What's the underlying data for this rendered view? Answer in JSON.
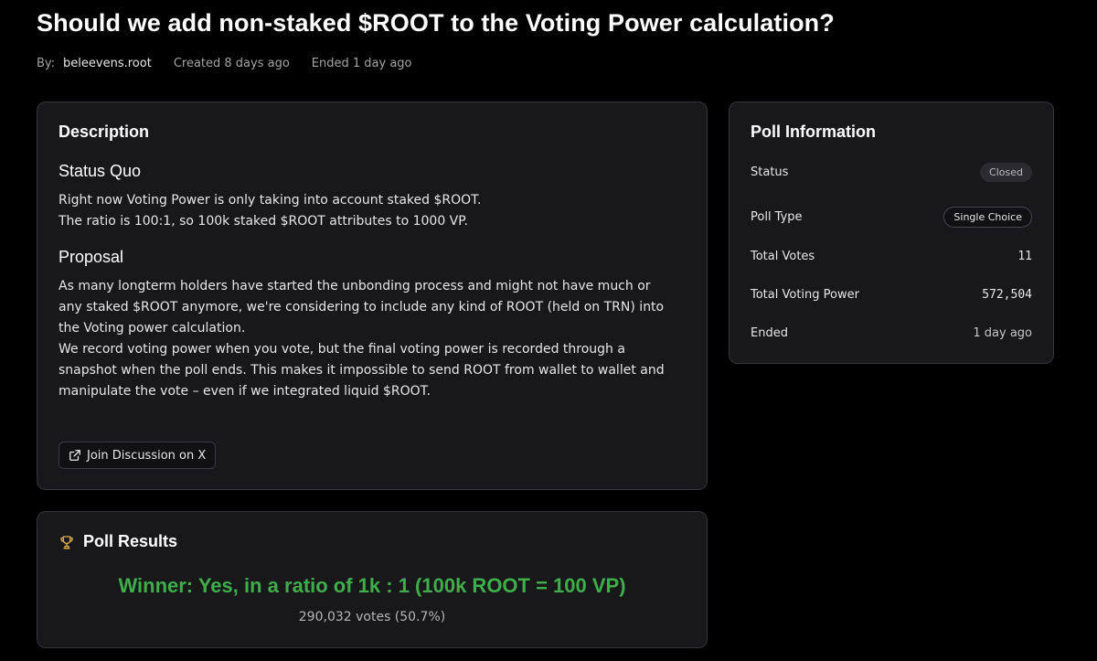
{
  "poll": {
    "title": "Should we add non-staked $ROOT to the Voting Power calculation?",
    "author_label": "By:",
    "author": "beleevens.root",
    "created": "Created 8 days ago",
    "ended": "Ended 1 day ago"
  },
  "description": {
    "heading": "Description",
    "status_quo": {
      "heading": "Status Quo",
      "lines": [
        "Right now Voting Power is only taking into account staked $ROOT.",
        "The ratio is 100:1, so 100k staked $ROOT attributes to 1000 VP."
      ]
    },
    "proposal": {
      "heading": "Proposal",
      "lines": [
        "As many longterm holders have started the unbonding process and might not have much or",
        "any staked $ROOT anymore, we're considering to include any kind of ROOT (held on TRN) into",
        "the Voting power calculation.",
        "We record voting power when you vote, but the final voting power is recorded through a",
        "snapshot when the poll ends. This makes it impossible to send ROOT from wallet to wallet and",
        "manipulate the vote – even if we integrated liquid $ROOT."
      ]
    },
    "discussion_button": "Join Discussion on X",
    "discussion_icon": "external-link-icon"
  },
  "poll_info": {
    "heading": "Poll Information",
    "status_label": "Status",
    "status_value": "Closed",
    "type_label": "Poll Type",
    "type_value": "Single Choice",
    "votes_label": "Total Votes",
    "votes_value": "11",
    "power_label": "Total Voting Power",
    "power_value": "572,504",
    "ended_label": "Ended",
    "ended_value": "1 day ago"
  },
  "results": {
    "heading": "Poll Results",
    "icon": "trophy-icon",
    "winner": "Winner: Yes, in a ratio of 1k : 1 (100k ROOT = 100 VP)",
    "votes": "290,032 votes (50.7%)",
    "winner_color": "#3fae4a",
    "icon_color": "#e0b04a"
  }
}
